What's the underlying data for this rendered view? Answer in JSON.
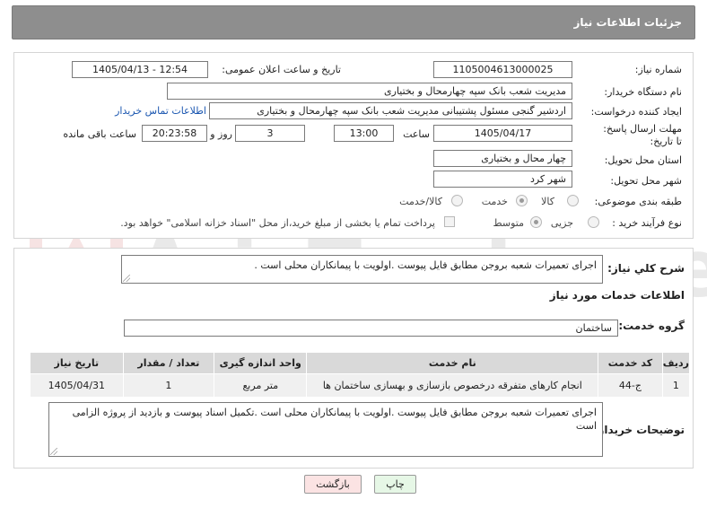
{
  "header": {
    "title": "جزئیات اطلاعات نیاز"
  },
  "labels": {
    "need_number": "شماره نیاز:",
    "announce_datetime": "تاریخ و ساعت اعلان عمومی:",
    "buyer_org": "نام دستگاه خریدار:",
    "requester": "ایجاد کننده درخواست:",
    "deadline": "مهلت ارسال پاسخ: تا تاریخ:",
    "hour": "ساعت",
    "day_and": "روز و",
    "remaining": "ساعت باقی مانده",
    "province": "استان محل تحویل:",
    "city": "شهر محل تحویل:",
    "category": "طبقه بندی موضوعی:",
    "purchase_type": "نوع فرآیند خرید :",
    "description": "شرح كلي نياز:",
    "services_info": "اطلاعات خدمات مورد نیاز",
    "service_group": "گروه خدمت:",
    "buyer_notes": "توضیحات خریدار:"
  },
  "values": {
    "need_number": "1105004613000025",
    "announce_datetime": "1405/04/13 - 12:54",
    "buyer_org": "مدیریت شعب بانک سپه چهارمحال و بختیاری",
    "requester": "اردشیر گنجی مسئول پشتیبانی مدیریت شعب بانک سپه چهارمحال و بختیاری",
    "contact_link": "اطلاعات تماس خریدار",
    "deadline_date": "1405/04/17",
    "deadline_time": "13:00",
    "days": "3",
    "remaining_time": "20:23:58",
    "province": "چهار محال و بختیاری",
    "city": "شهر کرد",
    "description": "اجرای تعمیرات شعبه بروجن مطابق فایل پیوست .اولویت با پیمانکاران محلی است .",
    "service_group": "ساختمان",
    "buyer_notes": "اجرای تعمیرات شعبه بروجن مطابق فایل پیوست .اولویت با پیمانکاران محلی است .تکمیل اسناد پیوست و بازدید از پروژه الزامی است"
  },
  "category_options": {
    "goods": "کالا",
    "service": "خدمت",
    "goods_service": "کالا/خدمت",
    "selected": "service"
  },
  "purchase_options": {
    "partial": "جزیی",
    "medium": "متوسط",
    "selected": "medium",
    "treasury_note": "پرداخت تمام یا بخشی از مبلغ خرید،از محل \"اسناد خزانه اسلامی\" خواهد بود."
  },
  "table": {
    "headers": [
      "ردیف",
      "کد خدمت",
      "نام خدمت",
      "واحد اندازه گیری",
      "تعداد / مقدار",
      "تاریخ نیاز"
    ],
    "rows": [
      [
        "1",
        "ج-44",
        "انجام کارهای متفرقه درخصوص بازسازی و بهسازی ساختمان ها",
        "متر مربع",
        "1",
        "1405/04/31"
      ]
    ]
  },
  "buttons": {
    "print": "چاپ",
    "back": "بازگشت"
  },
  "watermark": {
    "text": "AriaTender.net"
  },
  "colors": {
    "header_bg": "#8e8e8e",
    "link": "#1a56b0",
    "print_btn": "#e6f7e6",
    "back_btn": "#fbe3e3"
  }
}
